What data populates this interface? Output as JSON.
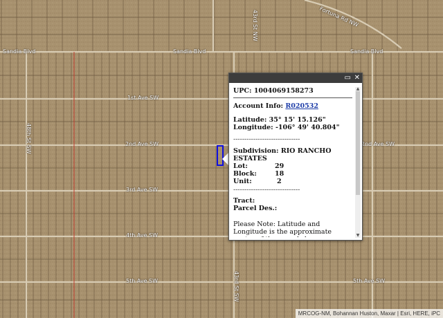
{
  "map": {
    "roads": [
      {
        "id": "sandia-blvd-w",
        "label": "Sandia Blvd"
      },
      {
        "id": "sandia-blvd-c",
        "label": "Sandia Blvd"
      },
      {
        "id": "sandia-blvd-e",
        "label": "Sandia Blvd"
      },
      {
        "id": "1st-ave",
        "label": "1st Ave SW"
      },
      {
        "id": "2nd-ave",
        "label": "2nd Ave SW"
      },
      {
        "id": "2nd-ave-e",
        "label": "2nd Ave SW"
      },
      {
        "id": "3rd-ave",
        "label": "3rd Ave SW"
      },
      {
        "id": "4th-ave",
        "label": "4th Ave SW"
      },
      {
        "id": "5th-ave",
        "label": "5th Ave SW"
      },
      {
        "id": "5th-ave-e",
        "label": "5th Ave SW"
      },
      {
        "id": "fortuna-rd",
        "label": "Fortuna Rd NW"
      },
      {
        "id": "st-nw",
        "label": "43rd St NW"
      },
      {
        "id": "st-sw-left",
        "label": "48th St SW"
      },
      {
        "id": "st-sw-bottom",
        "label": "43rd St SW"
      }
    ],
    "colors": {
      "parcel_outline": "#1010e0",
      "road": "#d8ccb4",
      "lot_line": "#5c4a34"
    }
  },
  "popup": {
    "title_buttons": {
      "maximize": "▭",
      "close": "✕"
    },
    "upc_label": "UPC:",
    "upc_value": "1004069158273",
    "account_label": "Account Info:",
    "account_link": "R020532",
    "latitude_label": "Latitude:",
    "latitude_value": "35° 15' 15.126\"",
    "longitude_label": "Longitude:",
    "longitude_value": "-106° 49' 40.804\"",
    "dashes": "------------------------------",
    "subdivision_label": "Subdivision:",
    "subdivision_value": "RIO RANCHO ESTATES",
    "lot_label": "Lot:",
    "lot_value": "29",
    "block_label": "Block:",
    "block_value": "18",
    "unit_label": "Unit:",
    "unit_value": "2",
    "tract_label": "Tract:",
    "parcel_des_label": "Parcel Des.:",
    "note": "Please Note: Latitude and Longitude is the approximate center of the parcel shown."
  },
  "attribution": "MRCOG-NM, Bohannan Huston, Maxar | Esri, HERE, iPC"
}
